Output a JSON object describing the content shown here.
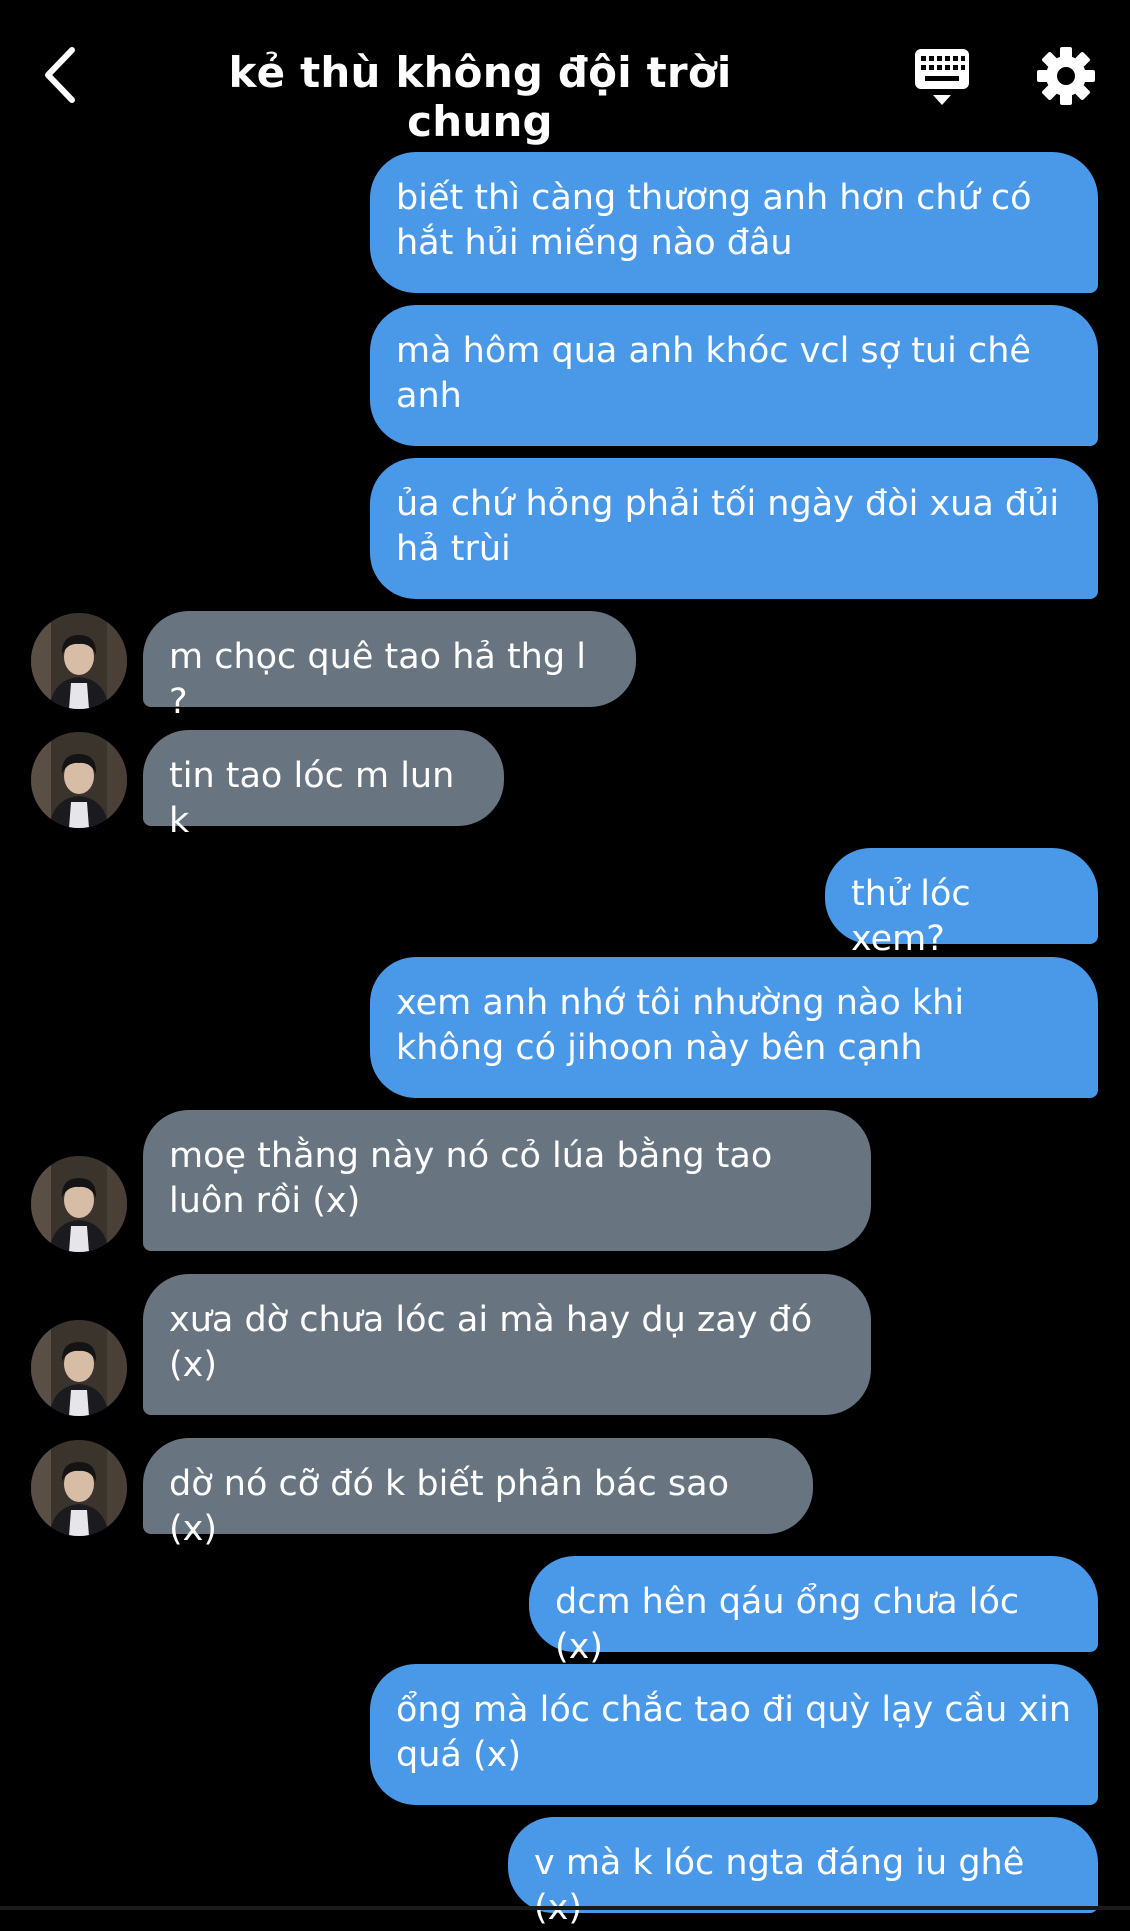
{
  "header": {
    "title": "kẻ thù không đội trời chung",
    "back_icon": "chevron-left-icon",
    "keyboard_icon": "keyboard-icon",
    "settings_icon": "gear-icon"
  },
  "colors": {
    "outgoing_bubble": "#4a99e9",
    "incoming_bubble": "#687480",
    "background": "#000000"
  },
  "messages": [
    {
      "side": "out",
      "text": "biết thì càng thương anh hơn chứ có hắt hủi miếng nào đâu"
    },
    {
      "side": "out",
      "text": "mà hôm qua anh khóc vcl sợ tui chê anh"
    },
    {
      "side": "out",
      "text": "ủa chứ hỏng phải tối ngày đòi xua đủi hả trùi"
    },
    {
      "side": "in",
      "text": "m chọc quê tao hả thg l ?"
    },
    {
      "side": "in",
      "text": "tin tao lóc m lun k"
    },
    {
      "side": "out",
      "text": "thử lóc xem?"
    },
    {
      "side": "out",
      "text": "xem anh nhớ tôi nhường nào khi không có jihoon này bên cạnh"
    },
    {
      "side": "in",
      "text": "moẹ thằng này nó cỏ lúa bằng tao luôn rồi (x)"
    },
    {
      "side": "in",
      "text": "xưa dờ chưa lóc ai mà hay dụ zay đó (x)"
    },
    {
      "side": "in",
      "text": "dờ nó cỡ đó k biết phản bác sao (x)"
    },
    {
      "side": "out",
      "text": "dcm hên qáu ổng chưa lóc (x)"
    },
    {
      "side": "out",
      "text": "ổng mà lóc chắc tao đi quỳ lạy cầu xin quá (x)"
    },
    {
      "side": "out",
      "text": "v mà k lóc ngta đáng iu ghê (x)"
    }
  ]
}
